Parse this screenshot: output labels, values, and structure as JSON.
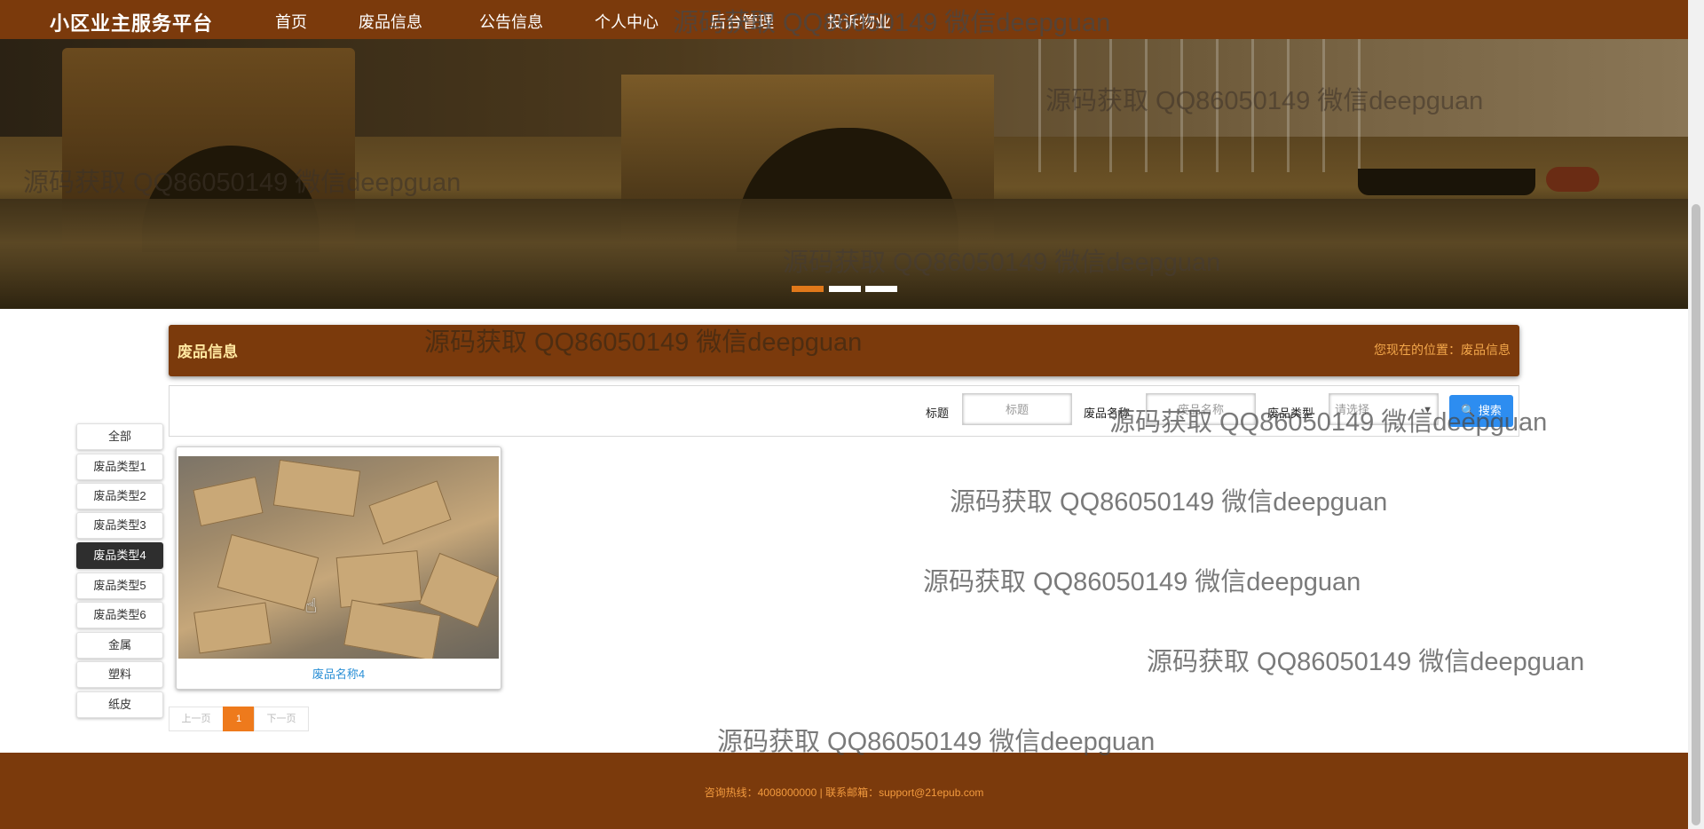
{
  "brand": "小区业主服务平台",
  "nav": [
    "首页",
    "废品信息",
    "公告信息",
    "个人中心",
    "后台管理",
    "投诉物业"
  ],
  "watermark": "源码获取 QQ86050149 微信deepguan",
  "section": {
    "title": "废品信息",
    "breadcrumb_prefix": "您现在的位置：",
    "breadcrumb_current": "废品信息"
  },
  "search": {
    "title_label": "标题",
    "title_placeholder": "标题",
    "name_label": "废品名称",
    "name_placeholder": "废品名称",
    "type_label": "废品类型",
    "type_selected": "请选择",
    "button": "搜索"
  },
  "categories": [
    "全部",
    "废品类型1",
    "废品类型2",
    "废品类型3",
    "废品类型4",
    "废品类型5",
    "废品类型6",
    "金属",
    "塑料",
    "纸皮"
  ],
  "active_category": "废品类型4",
  "item": {
    "title": "废品名称4"
  },
  "pagination": {
    "prev": "上一页",
    "current": "1",
    "next": "下一页"
  },
  "footer": "咨询热线：4008000000 | 联系邮箱：support@21epub.com",
  "colors": {
    "nav_bg": "#7b3a0c",
    "accent_orange": "#ee7a1c",
    "search_blue": "#2d8df0",
    "section_title": "#ffe7a0"
  }
}
